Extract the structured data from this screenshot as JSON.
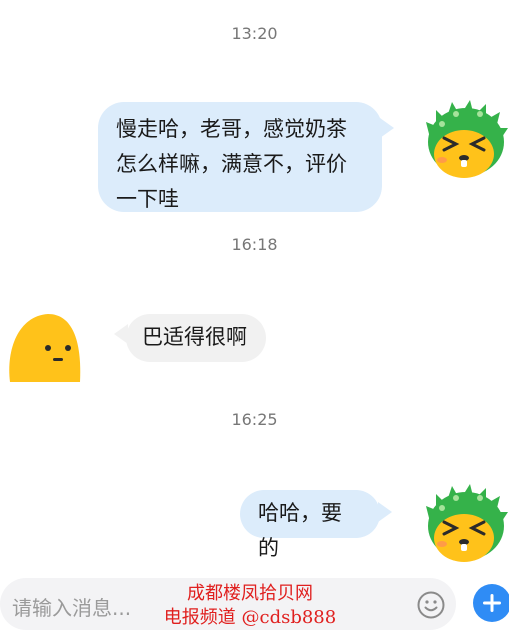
{
  "messages": [
    {
      "type": "timestamp",
      "text": "13:20"
    },
    {
      "type": "outgoing",
      "text": "慢走哈，老哥，感觉奶茶怎么样嘛，满意不，评价一下哇",
      "lines": [
        "慢走哈，老哥，感觉奶茶",
        "怎么样嘛，满意不，评价",
        "一下哇"
      ],
      "avatar": "green-dino-avatar"
    },
    {
      "type": "timestamp",
      "text": "16:18"
    },
    {
      "type": "incoming",
      "text": "巴适得很啊",
      "avatar": "yellow-blob-avatar"
    },
    {
      "type": "timestamp",
      "text": "16:25"
    },
    {
      "type": "outgoing",
      "text": "哈哈，要的",
      "avatar": "green-dino-avatar"
    }
  ],
  "input": {
    "placeholder": "请输入消息..."
  },
  "icons": {
    "emoji": "smiley-icon",
    "add": "plus-icon"
  },
  "watermark": {
    "line1": "成都楼凤拾贝网",
    "line2": "电报频道 @cdsb888"
  },
  "colors": {
    "outgoing_bubble": "#dcecfb",
    "incoming_bubble": "#f1f1f1",
    "accent": "#2f8cf5",
    "watermark": "#e0201f"
  }
}
